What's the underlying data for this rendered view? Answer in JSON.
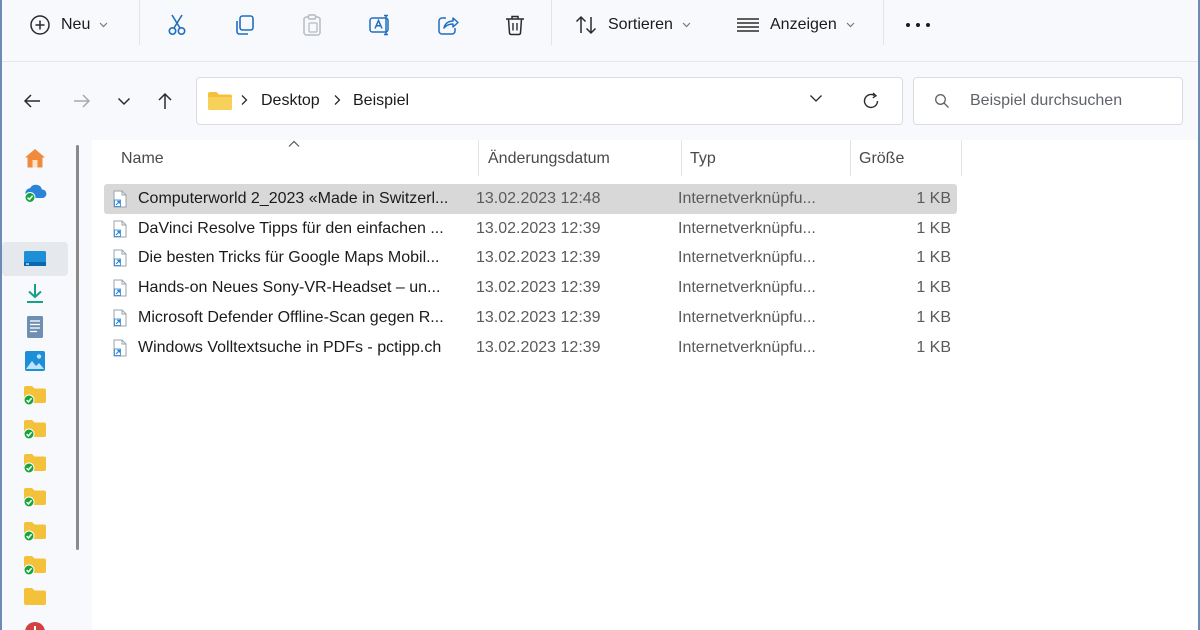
{
  "toolbar": {
    "new_label": "Neu",
    "sort_label": "Sortieren",
    "view_label": "Anzeigen"
  },
  "address": {
    "crumbs": [
      "Desktop",
      "Beispiel"
    ]
  },
  "search": {
    "placeholder": "Beispiel durchsuchen"
  },
  "columns": {
    "name": "Name",
    "date": "Änderungsdatum",
    "type": "Typ",
    "size": "Größe"
  },
  "files": [
    {
      "name": "Computerworld 2_2023 «Made in Switzerl...",
      "date": "13.02.2023 12:48",
      "type": "Internetverknüpfu...",
      "size": "1 KB",
      "selected": true
    },
    {
      "name": "DaVinci Resolve Tipps für den einfachen ...",
      "date": "13.02.2023 12:39",
      "type": "Internetverknüpfu...",
      "size": "1 KB"
    },
    {
      "name": "Die besten Tricks für Google Maps Mobil...",
      "date": "13.02.2023 12:39",
      "type": "Internetverknüpfu...",
      "size": "1 KB"
    },
    {
      "name": "Hands-on Neues Sony-VR-Headset – un...",
      "date": "13.02.2023 12:39",
      "type": "Internetverknüpfu...",
      "size": "1 KB"
    },
    {
      "name": "Microsoft Defender Offline-Scan gegen R...",
      "date": "13.02.2023 12:39",
      "type": "Internetverknüpfu...",
      "size": "1 KB"
    },
    {
      "name": "Windows Volltextsuche in PDFs - pctipp.ch",
      "date": "13.02.2023 12:39",
      "type": "Internetverknüpfu...",
      "size": "1 KB"
    }
  ],
  "sidebar": {
    "items": [
      {
        "icon": "home-icon"
      },
      {
        "icon": "onedrive-icon"
      },
      {
        "icon": "desktop-icon",
        "selected": true
      },
      {
        "icon": "downloads-icon"
      },
      {
        "icon": "documents-icon"
      },
      {
        "icon": "pictures-icon"
      },
      {
        "icon": "synced-folder-icon"
      },
      {
        "icon": "synced-folder-icon"
      },
      {
        "icon": "synced-folder-icon"
      },
      {
        "icon": "synced-folder-icon"
      },
      {
        "icon": "synced-folder-icon"
      },
      {
        "icon": "synced-folder-icon"
      },
      {
        "icon": "folder-icon"
      },
      {
        "icon": "red-badge-icon"
      }
    ]
  },
  "colors": {
    "accent": "#0a5fb4",
    "folder": "#f3c13a",
    "sync_check": "#15a53a",
    "selection": "#d8d8d8"
  }
}
